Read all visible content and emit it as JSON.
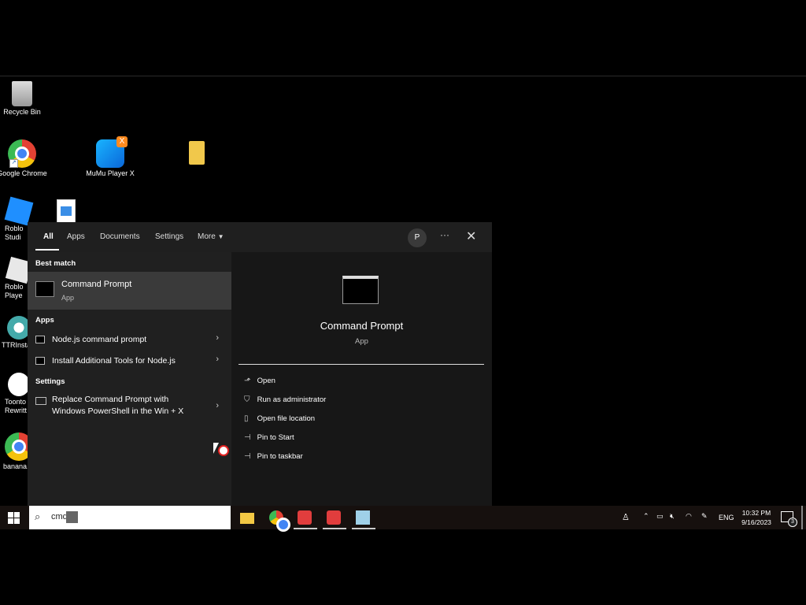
{
  "desktop": {
    "icons": [
      {
        "label": "Recycle Bin"
      },
      {
        "label": "Google Chrome"
      },
      {
        "label": "MuMu Player X"
      },
      {
        "label": "Roblo Studi"
      },
      {
        "label": "Roblo Playe"
      },
      {
        "label": "TTRInsta"
      },
      {
        "label": "Toonto Rewritt"
      },
      {
        "label": "banana.l"
      }
    ]
  },
  "search_menu": {
    "tabs": [
      "All",
      "Apps",
      "Documents",
      "Settings",
      "More"
    ],
    "avatar_initial": "P",
    "best_match_label": "Best match",
    "best_match": {
      "title": "Command Prompt",
      "subtitle": "App"
    },
    "apps_label": "Apps",
    "apps": [
      {
        "label": "Node.js command prompt"
      },
      {
        "label": "Install Additional Tools for Node.js"
      }
    ],
    "settings_label": "Settings",
    "settings": [
      {
        "line1": "Replace Command Prompt with",
        "line2": "Windows PowerShell in the Win + X"
      }
    ],
    "preview": {
      "title": "Command Prompt",
      "subtitle": "App"
    },
    "actions": [
      {
        "label": "Open",
        "icon": "open-icon"
      },
      {
        "label": "Run as administrator",
        "icon": "shield-icon"
      },
      {
        "label": "Open file location",
        "icon": "file-location-icon"
      },
      {
        "label": "Pin to Start",
        "icon": "pin-icon"
      },
      {
        "label": "Pin to taskbar",
        "icon": "pin-icon"
      }
    ]
  },
  "taskbar": {
    "search_value": "cmd",
    "language": "ENG",
    "time": "10:32 PM",
    "date": "9/16/2023",
    "notification_count": "3"
  },
  "colors": {
    "accent": "#0078d4",
    "menu_bg": "#1f1f1f",
    "selected_bg": "#3a3a3a"
  }
}
